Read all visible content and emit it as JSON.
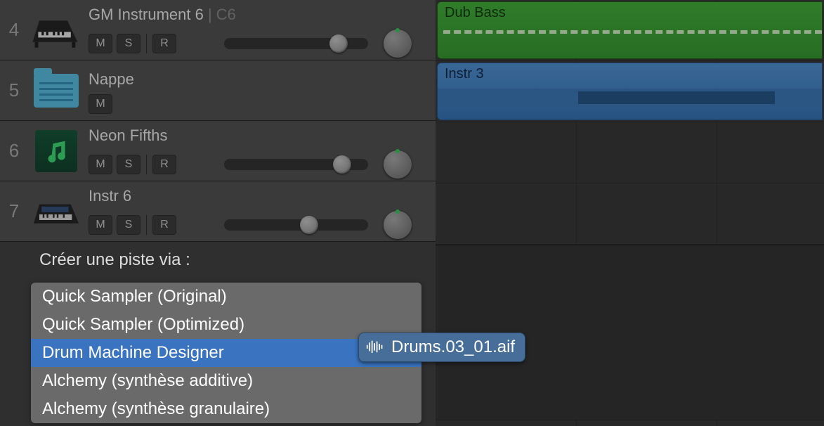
{
  "tracks": [
    {
      "num": "4",
      "name": "GM Instrument 6",
      "suffix": " | C6",
      "msr": [
        "M",
        "S",
        "R"
      ],
      "sliderPos": 150,
      "icon": "piano"
    },
    {
      "num": "5",
      "name": "Nappe",
      "suffix": "",
      "msr": [
        "M"
      ],
      "icon": "folder"
    },
    {
      "num": "6",
      "name": "Neon Fifths",
      "suffix": "",
      "msr": [
        "M",
        "S",
        "R"
      ],
      "sliderPos": 155,
      "icon": "note"
    },
    {
      "num": "7",
      "name": "Instr 6",
      "suffix": "",
      "msr": [
        "M",
        "S",
        "R"
      ],
      "sliderPos": 108,
      "icon": "synth"
    }
  ],
  "clips": {
    "dubBass": "Dub Bass",
    "instr3": "Instr 3"
  },
  "createVia": {
    "title": "Créer une piste via :",
    "items": [
      "Quick Sampler (Original)",
      "Quick Sampler (Optimized)",
      "Drum Machine Designer",
      "Alchemy (synthèse additive)",
      "Alchemy (synthèse granulaire)"
    ],
    "highlightIndex": 2
  },
  "dragFile": "Drums.03_01.aif"
}
